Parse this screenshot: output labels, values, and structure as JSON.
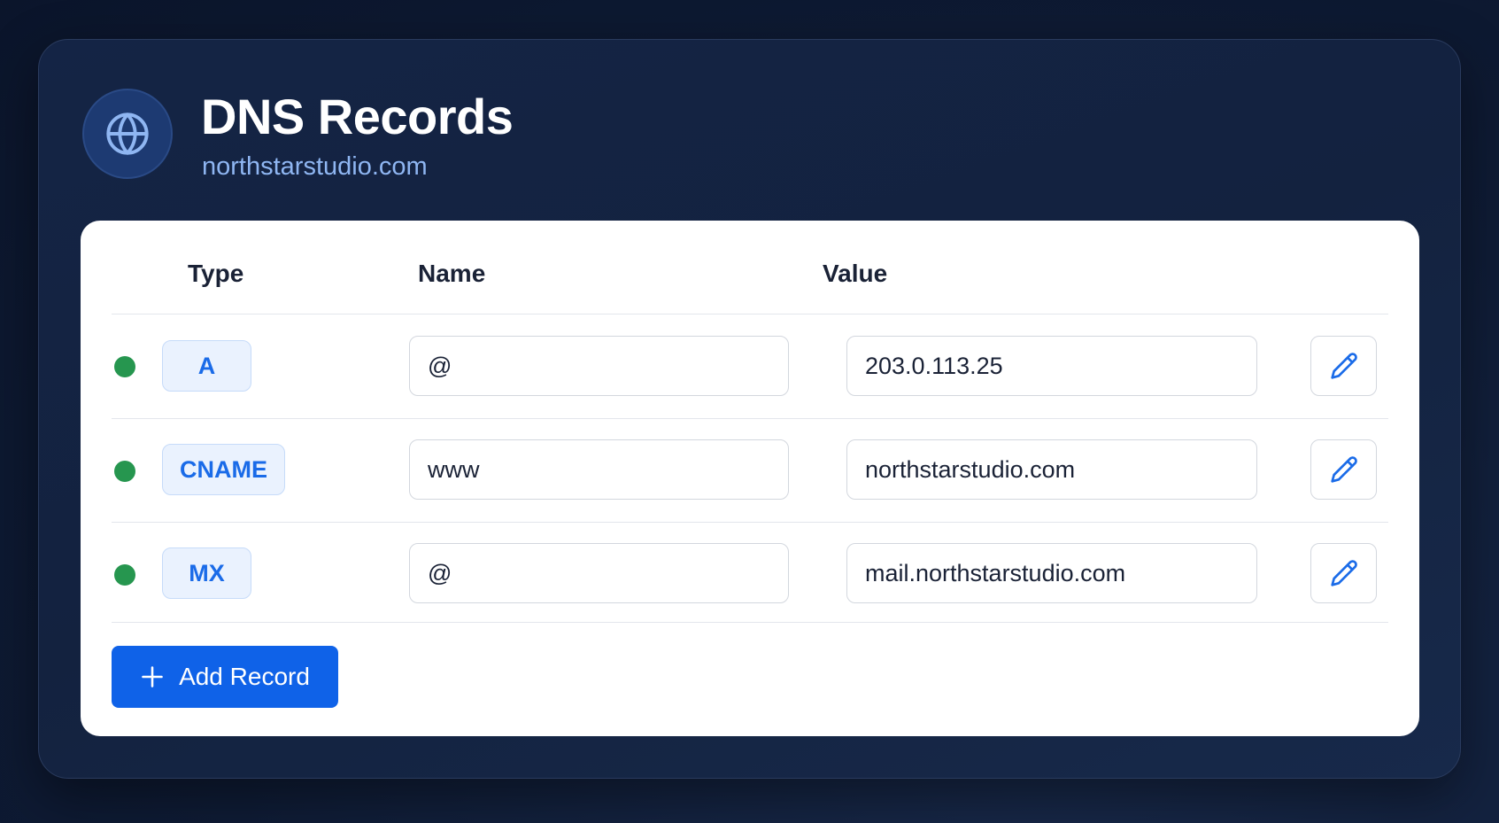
{
  "header": {
    "title": "DNS Records",
    "domain": "northstarstudio.com",
    "icon": "globe-icon"
  },
  "table": {
    "columns": [
      "Type",
      "Name",
      "Value"
    ],
    "rows": [
      {
        "status": "active",
        "type": "A",
        "name": "@",
        "value": "203.0.113.25"
      },
      {
        "status": "active",
        "type": "CNAME",
        "name": "www",
        "value": "northstarstudio.com"
      },
      {
        "status": "active",
        "type": "MX",
        "name": "@",
        "value": "mail.northstarstudio.com"
      }
    ]
  },
  "actions": {
    "add_label": "Add Record"
  },
  "colors": {
    "background": "#0e1a33",
    "accent": "#0f62e8",
    "status_active": "#26964f",
    "type_badge_text": "#1a6be8",
    "subtitle": "#8fb6f2"
  }
}
